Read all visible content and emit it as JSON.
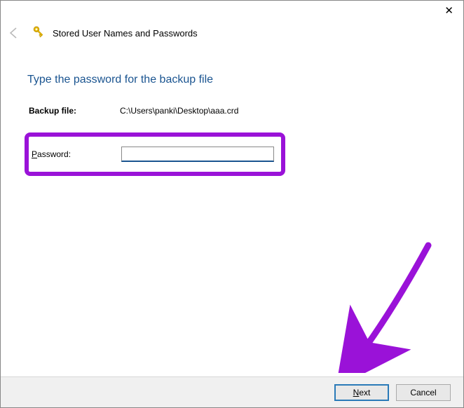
{
  "window": {
    "title": "Stored User Names and Passwords"
  },
  "wizard": {
    "heading": "Type the password for the backup file",
    "backup_label": "Backup file:",
    "backup_path": "C:\\Users\\panki\\Desktop\\aaa.crd",
    "password_label_prefix": "P",
    "password_label_rest": "assword:"
  },
  "buttons": {
    "next_prefix": "N",
    "next_rest": "ext",
    "cancel": "Cancel"
  }
}
